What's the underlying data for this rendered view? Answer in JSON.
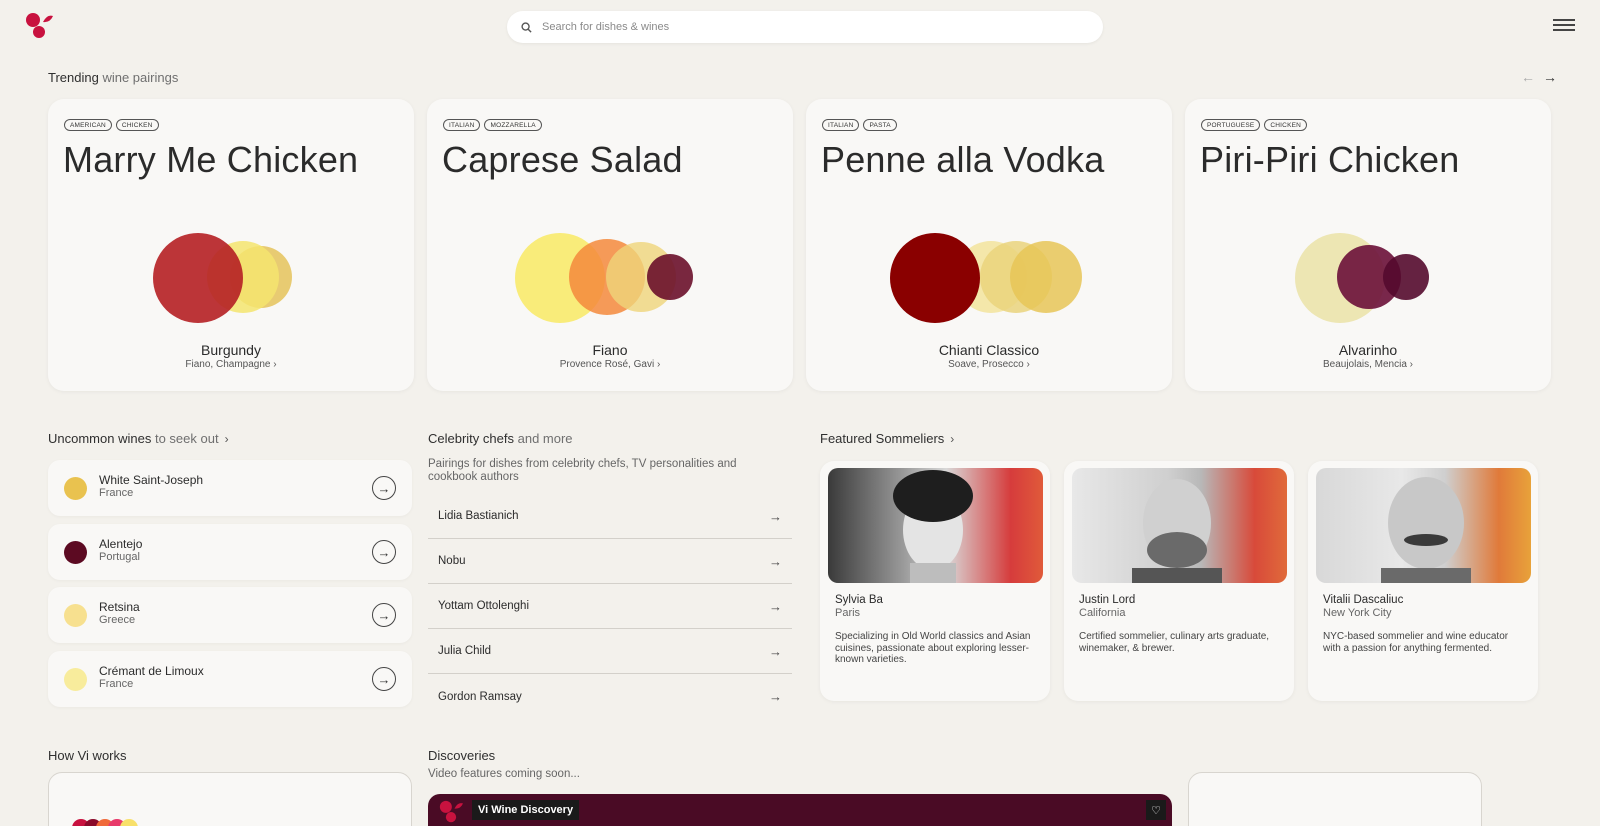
{
  "search": {
    "placeholder": "Search for dishes & wines"
  },
  "trending": {
    "title": "Trending",
    "title_muted": "wine pairings"
  },
  "cards": [
    {
      "tags": [
        "AMERICAN",
        "CHICKEN"
      ],
      "dish": "Marry Me Chicken",
      "wine": "Burgundy",
      "alternatives": "Fiano, Champagne"
    },
    {
      "tags": [
        "ITALIAN",
        "MOZZARELLA"
      ],
      "dish": "Caprese Salad",
      "wine": "Fiano",
      "alternatives": "Provence Rosé, Gavi"
    },
    {
      "tags": [
        "ITALIAN",
        "PASTA"
      ],
      "dish": "Penne alla Vodka",
      "wine": "Chianti Classico",
      "alternatives": "Soave, Prosecco"
    },
    {
      "tags": [
        "PORTUGUESE",
        "CHICKEN"
      ],
      "dish": "Piri-Piri Chicken",
      "wine": "Alvarinho",
      "alternatives": "Beaujolais, Mencia"
    }
  ],
  "uncommon": {
    "title": "Uncommon wines",
    "title_muted": "to seek out",
    "items": [
      {
        "name": "White Saint-Joseph",
        "country": "France",
        "color": "#e9c24f"
      },
      {
        "name": "Alentejo",
        "country": "Portugal",
        "color": "#5c0a22"
      },
      {
        "name": "Retsina",
        "country": "Greece",
        "color": "#f7e08f"
      },
      {
        "name": "Crémant de Limoux",
        "country": "France",
        "color": "#f8ec9c"
      }
    ]
  },
  "chefs": {
    "title": "Celebrity chefs",
    "title_muted": "and more",
    "subtitle": "Pairings for dishes from celebrity chefs, TV personalities and cookbook authors",
    "items": [
      "Lidia Bastianich",
      "Nobu",
      "Yottam Ottolenghi",
      "Julia Child",
      "Gordon Ramsay"
    ]
  },
  "sommeliers": {
    "title": "Featured Sommeliers",
    "items": [
      {
        "name": "Sylvia Ba",
        "city": "Paris",
        "bio": "Specializing in Old World classics and Asian cuisines, passionate about exploring lesser-known varieties."
      },
      {
        "name": "Justin Lord",
        "city": "California",
        "bio": "Certified sommelier, culinary arts graduate, winemaker, & brewer."
      },
      {
        "name": "Vitalii Dascaliuc",
        "city": "New York City",
        "bio": "NYC-based sommelier and wine educator with a passion for anything fermented."
      }
    ]
  },
  "how": {
    "title": "How Vi works"
  },
  "discoveries": {
    "title": "Discoveries",
    "subtitle": "Video features coming soon...",
    "video_badge": "Vi Wine Discovery"
  },
  "colors": {
    "brand": "#c8123f",
    "background": "#f3f1ec",
    "card": "#f9f8f6"
  }
}
